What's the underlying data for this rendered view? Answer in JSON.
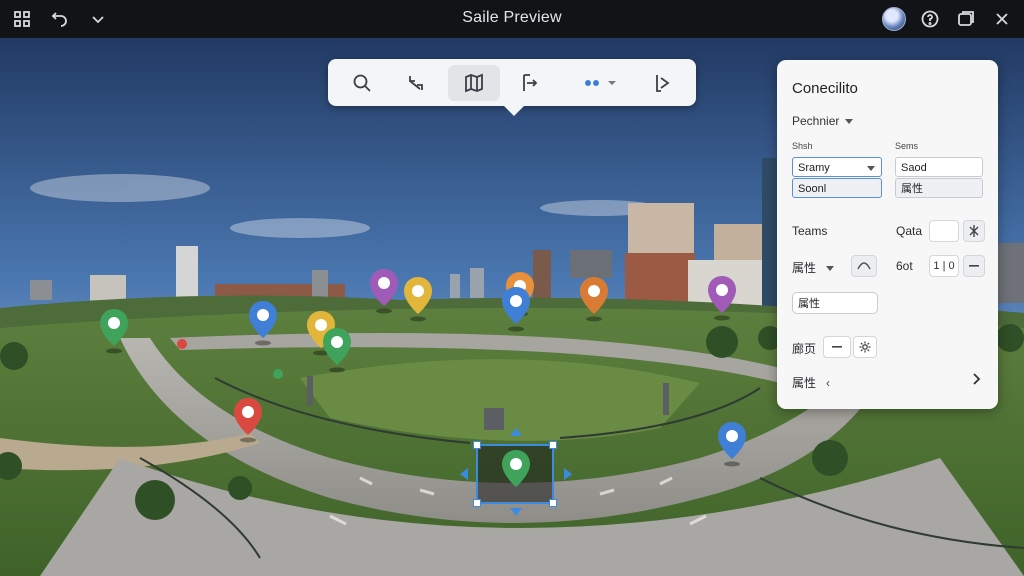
{
  "window": {
    "title": "Saile Preview",
    "left_icons": [
      "grid-icon",
      "undo-icon",
      "chevron-down-icon"
    ],
    "right_icons": [
      "avatar",
      "help-icon",
      "window-icon",
      "close-icon"
    ]
  },
  "toolbar": {
    "tools": [
      "search-icon",
      "rotate-icon",
      "map-icon",
      "export-icon",
      "more-dots-icon",
      "share-icon"
    ],
    "active_tool": "map-icon"
  },
  "panel": {
    "title": "Conecilito",
    "dropdown": "Pechnier",
    "label_a": "Shsh",
    "label_b": "Sems",
    "field_a_value": "Sramy",
    "field_a_sub": "Soonl",
    "field_b_value": "Saod",
    "field_b_sub": "属性",
    "row1_label": "Teams",
    "row1_mid": "Qata",
    "row2_label": "属性",
    "row2_mid": "6ot",
    "row2_stepper": "1 | 0",
    "text_field_value": "属性",
    "row3_label": "廊页",
    "row4_label": "属性"
  },
  "pins": [
    {
      "color": "#3fa35b"
    },
    {
      "color": "#3f7fd6"
    },
    {
      "color": "#e1b63a"
    },
    {
      "color": "#3fa35b"
    },
    {
      "color": "#a05bb8"
    },
    {
      "color": "#e1b63a"
    },
    {
      "color": "#e8903a"
    },
    {
      "color": "#3f7fd6"
    },
    {
      "color": "#d97b35"
    },
    {
      "color": "#a05bb8"
    },
    {
      "color": "#d9493f"
    },
    {
      "color": "#3f7fd6"
    },
    {
      "color": "#3fa35b"
    }
  ]
}
